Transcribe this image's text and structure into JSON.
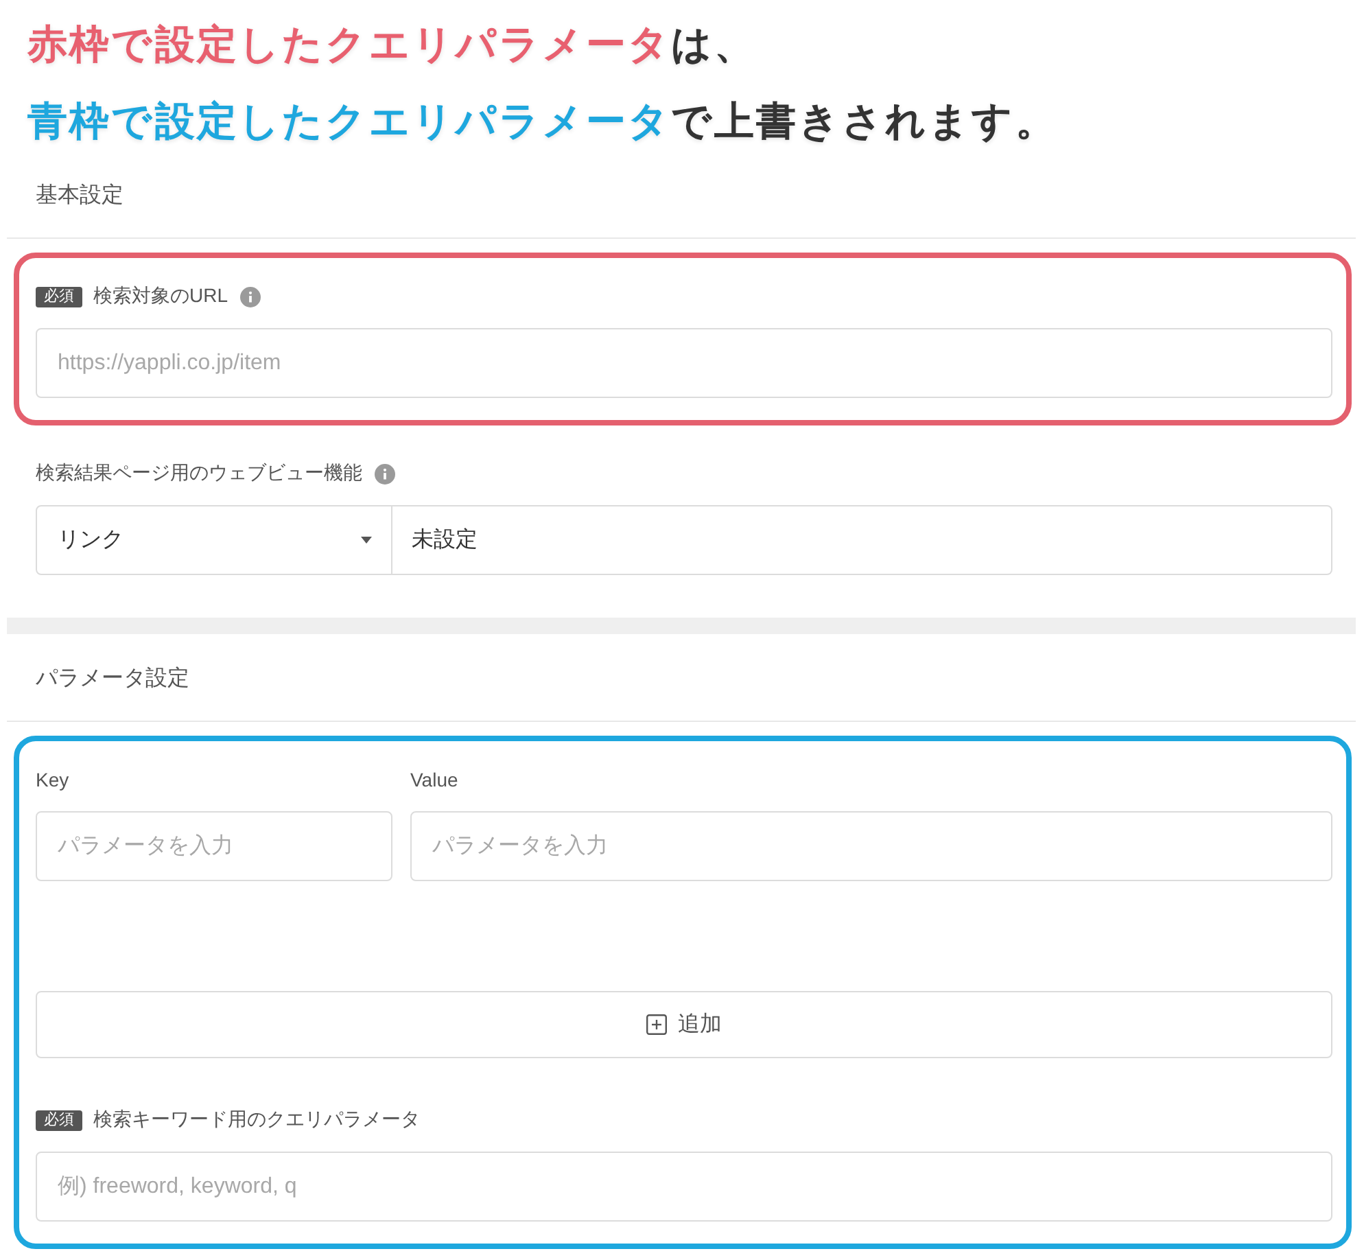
{
  "headline": [
    {
      "segments": [
        {
          "text": "赤枠で設定したクエリパラメータ",
          "color": "#e8606f"
        },
        {
          "text": "は、",
          "color": "#333333"
        }
      ]
    },
    {
      "segments": [
        {
          "text": "青枠で設定したクエリパラメータ",
          "color": "#1ea7de"
        },
        {
          "text": "で上書きされます。",
          "color": "#333333"
        }
      ]
    }
  ],
  "sections": [
    {
      "title": "基本設定",
      "blocks": [
        {
          "kind": "frame",
          "color": "#e4606e",
          "fields": [
            {
              "kind": "text",
              "badge": "必須",
              "label": "検索対象のURL",
              "info": true,
              "placeholder": "https://yappli.co.jp/item"
            }
          ]
        },
        {
          "kind": "select_pair",
          "label": "検索結果ページ用のウェブビュー機能",
          "info": true,
          "select": "リンク",
          "value": "未設定"
        }
      ]
    },
    {
      "title": "パラメータ設定",
      "blocks": [
        {
          "kind": "frame",
          "color": "#1ea7de",
          "fields": [
            {
              "kind": "key_value",
              "columns": [
                {
                  "label": "Key",
                  "placeholder": "パラメータを入力"
                },
                {
                  "label": "Value",
                  "placeholder": "パラメータを入力"
                }
              ]
            },
            {
              "kind": "add_button",
              "label": "追加"
            },
            {
              "kind": "text",
              "badge": "必須",
              "label": "検索キーワード用のクエリパラメータ",
              "info": false,
              "placeholder": "例) freeword, keyword, q"
            }
          ]
        }
      ]
    }
  ]
}
